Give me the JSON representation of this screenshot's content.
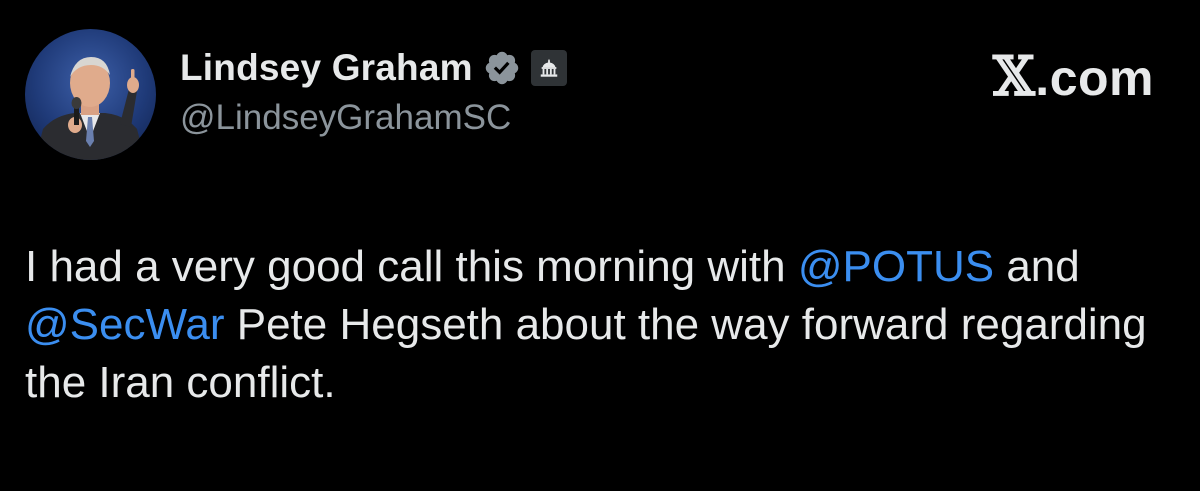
{
  "author": {
    "display_name": "Lindsey Graham",
    "handle": "@LindseyGrahamSC",
    "verified_icon": "verified-badge-icon",
    "affiliation_icon": "government-building-icon"
  },
  "brand": {
    "text": "X.com",
    "x_char": "𝕏",
    "rest": ".com"
  },
  "tweet": {
    "segments": [
      {
        "text": "I had a very good call this morning with ",
        "type": "text"
      },
      {
        "text": "@POTUS",
        "type": "mention"
      },
      {
        "text": " and ",
        "type": "text"
      },
      {
        "text": "@SecWar",
        "type": "mention"
      },
      {
        "text": " Pete Hegseth about the way forward regarding the Iran conflict.",
        "type": "text"
      }
    ]
  },
  "colors": {
    "background": "#000000",
    "text": "#e7e9ea",
    "secondary_text": "#8b949b",
    "mention": "#3b8ef0",
    "verified": "#1d9bf0"
  }
}
